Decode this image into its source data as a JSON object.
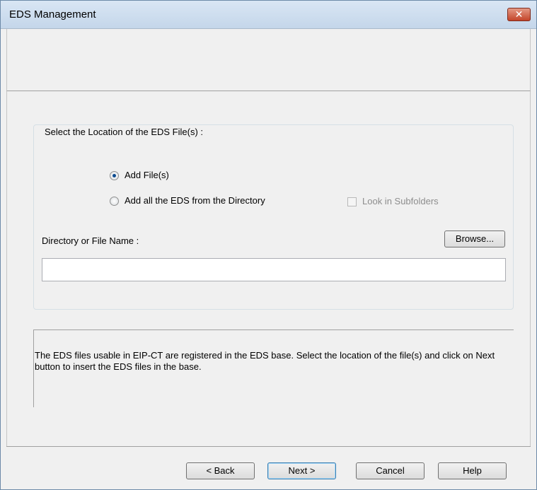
{
  "window": {
    "title": "EDS Management",
    "close_label": "✕"
  },
  "location_group": {
    "legend": "Select the Location of the EDS File(s) :",
    "options": [
      {
        "label": "Add File(s)",
        "selected": true
      },
      {
        "label": "Add all the EDS from the Directory",
        "selected": false
      }
    ],
    "subfolders_label": "Look in Subfolders",
    "subfolders_checked": false,
    "subfolders_enabled": false,
    "directory_label": "Directory or File Name :",
    "browse_label": "Browse...",
    "directory_value": ""
  },
  "info": {
    "text": "The EDS files usable in EIP-CT are registered in the EDS base. Select the location of the file(s) and click on Next button to insert the EDS files in the base."
  },
  "footer": {
    "back_label": "< Back",
    "next_label": "Next >",
    "cancel_label": "Cancel",
    "help_label": "Help"
  }
}
